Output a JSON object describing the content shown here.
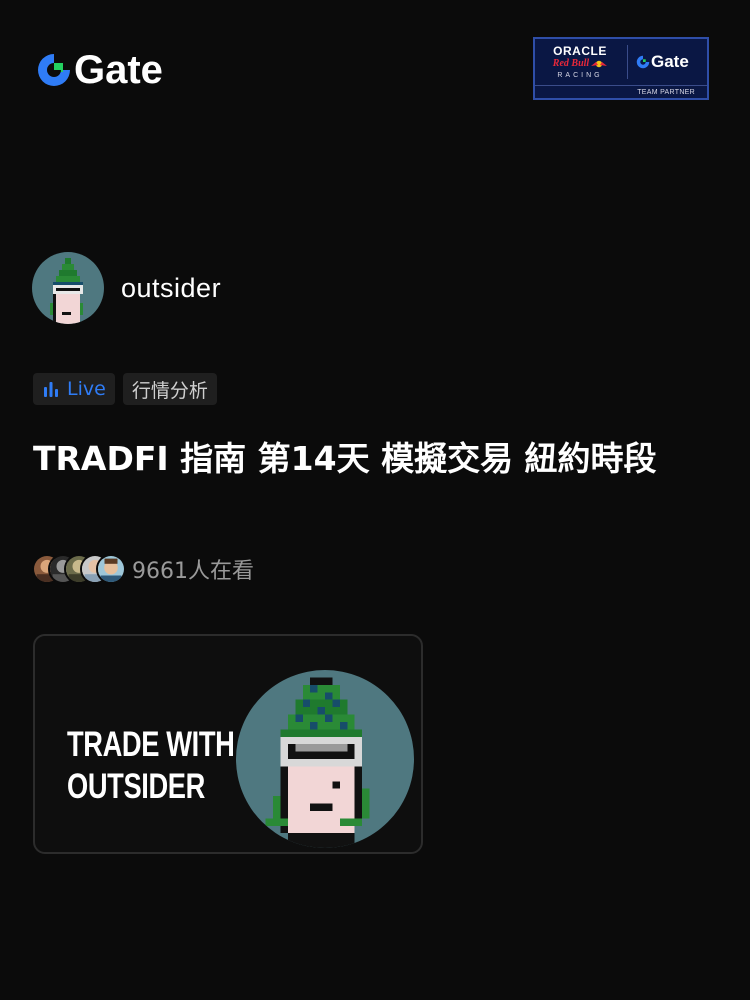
{
  "brand": {
    "name": "Gate",
    "accent_color": "#2f7cf6",
    "green_color": "#23d160"
  },
  "partner": {
    "oracle": "ORACLE",
    "redbull": "Red Bull",
    "racing": "RACING",
    "gate": "Gate",
    "team_partner": "TEAM PARTNER"
  },
  "host": {
    "name": "outsider"
  },
  "tags": {
    "live": "Live",
    "category": "行情分析"
  },
  "stream": {
    "title": "TRADFI 指南 第14天 模擬交易 紐約時段",
    "viewers_text": "9661人在看"
  },
  "cover": {
    "line1": "TRADE WITH",
    "line2": "OUTSIDER"
  }
}
